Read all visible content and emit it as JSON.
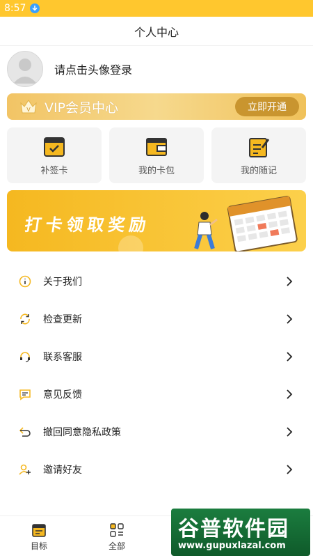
{
  "status_bar": {
    "time": "8:57"
  },
  "header": {
    "title": "个人中心"
  },
  "profile": {
    "login_prompt": "请点击头像登录"
  },
  "vip": {
    "title": "VIP会员中心",
    "button": "立即开通",
    "crown_letter": "V"
  },
  "cards": [
    {
      "label": "补签卡",
      "icon": "calendar-check-icon"
    },
    {
      "label": "我的卡包",
      "icon": "wallet-icon"
    },
    {
      "label": "我的随记",
      "icon": "notebook-edit-icon"
    }
  ],
  "banner": {
    "text": "打卡领取奖励"
  },
  "menu": [
    {
      "label": "关于我们",
      "icon": "info-icon"
    },
    {
      "label": "检查更新",
      "icon": "refresh-icon"
    },
    {
      "label": "联系客服",
      "icon": "headset-icon"
    },
    {
      "label": "意见反馈",
      "icon": "feedback-icon"
    },
    {
      "label": "撤回同意隐私政策",
      "icon": "undo-icon"
    },
    {
      "label": "邀请好友",
      "icon": "invite-user-icon"
    }
  ],
  "tabbar": [
    {
      "label": "目标",
      "icon": "calendar-icon"
    },
    {
      "label": "全部",
      "icon": "grid-icon"
    }
  ],
  "watermark": {
    "main": "谷普软件园",
    "url": "www.gupuxlazal.com"
  },
  "colors": {
    "accent": "#ffc72e",
    "icon": "#f5b820",
    "vip_button": "#c9952f"
  }
}
